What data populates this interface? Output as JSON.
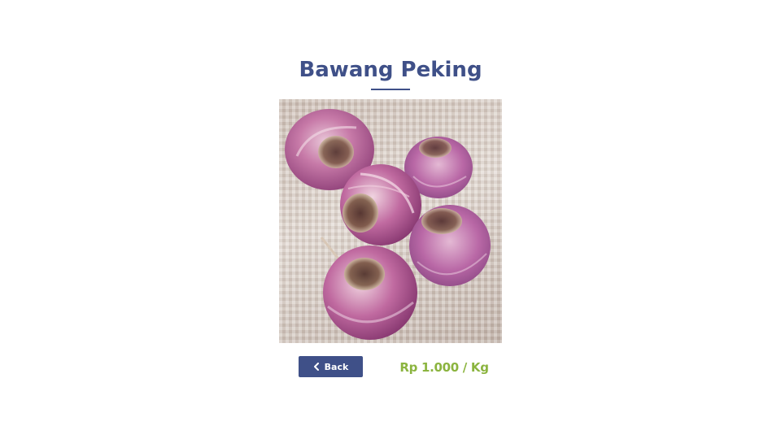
{
  "product": {
    "title": "Bawang Peking",
    "image_subject": "red onions",
    "price": "Rp 1.000 / Kg"
  },
  "actions": {
    "back_label": "Back",
    "back_icon": "chevron-left-icon"
  },
  "colors": {
    "title": "#3f5088",
    "button_bg": "#3f5088",
    "price": "#8bb43f",
    "background": "#ffffff"
  }
}
